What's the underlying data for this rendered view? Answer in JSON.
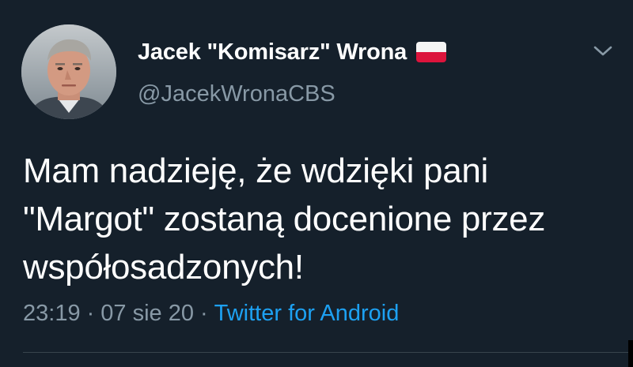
{
  "author": {
    "display_name": "Jacek \"Komisarz\" Wrona",
    "handle": "@JacekWronaCBS",
    "flag_icon": "poland-flag-icon",
    "avatar_icon": "user-avatar"
  },
  "tweet": {
    "text_lines": [
      "Mam nadzieję, że wdzięki pani",
      "\"Margot\" zostaną docenione przez",
      "współosadzonych!"
    ]
  },
  "meta": {
    "time": "23:19",
    "separator": "·",
    "date": "07 sie 20",
    "source": "Twitter for Android"
  },
  "colors": {
    "background": "#15202b",
    "text": "#ffffff",
    "secondary": "#8899a6",
    "link": "#1da1f2",
    "divider": "#38444d"
  }
}
